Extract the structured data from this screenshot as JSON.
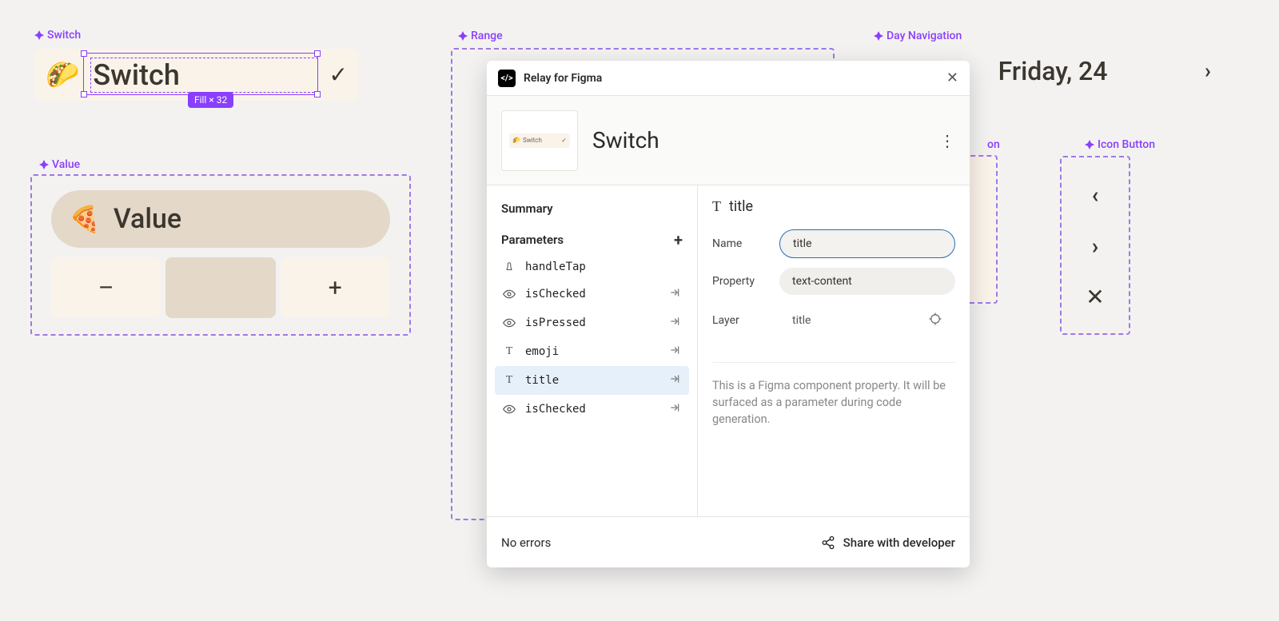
{
  "canvas": {
    "switch": {
      "label": "Switch",
      "emoji": "🌮",
      "title": "Switch",
      "check_glyph": "✓",
      "fill_badge": "Fill × 32"
    },
    "value": {
      "label": "Value",
      "emoji": "🍕",
      "title": "Value",
      "minus": "–",
      "plus": "+"
    },
    "range": {
      "label": "Range"
    },
    "day_nav": {
      "label": "Day Navigation",
      "title": "Friday, 24"
    },
    "icon_button": {
      "label": "Icon Button",
      "items": [
        "‹",
        "›",
        "✕"
      ]
    },
    "obscured_label": "on"
  },
  "relay": {
    "app_title": "Relay for Figma",
    "component_name": "Switch",
    "thumb_emoji": "🌮",
    "thumb_text": "Switch",
    "left": {
      "summary": "Summary",
      "parameters_heading": "Parameters",
      "params": [
        {
          "icon": "tap",
          "name": "handleTap",
          "has_arrow": false,
          "selected": false
        },
        {
          "icon": "eye",
          "name": "isChecked",
          "has_arrow": true,
          "selected": false
        },
        {
          "icon": "eye",
          "name": "isPressed",
          "has_arrow": true,
          "selected": false
        },
        {
          "icon": "text",
          "name": "emoji",
          "has_arrow": true,
          "selected": false
        },
        {
          "icon": "text",
          "name": "title",
          "has_arrow": true,
          "selected": true
        },
        {
          "icon": "eye",
          "name": "isChecked",
          "has_arrow": true,
          "selected": false
        }
      ]
    },
    "right": {
      "title_icon": "T",
      "title": "title",
      "name_label": "Name",
      "name_value": "title",
      "property_label": "Property",
      "property_value": "text-content",
      "layer_label": "Layer",
      "layer_value": "title",
      "description": "This is a Figma component property. It will be surfaced as a parameter during code generation."
    },
    "footer": {
      "errors": "No errors",
      "share": "Share with developer"
    }
  }
}
